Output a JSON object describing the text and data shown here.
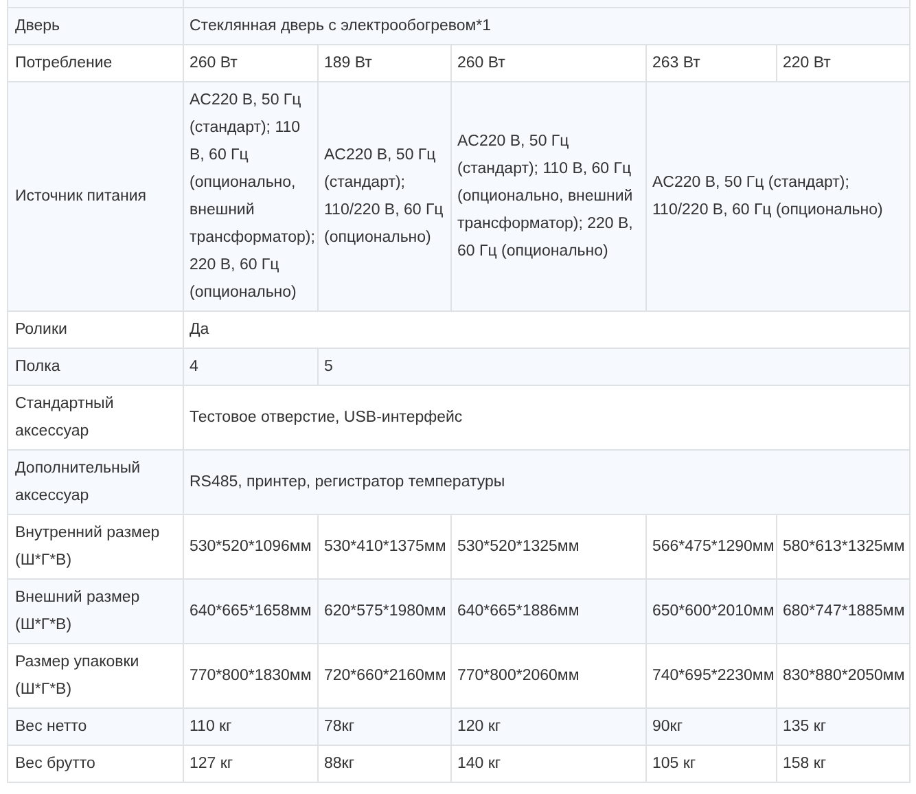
{
  "table": {
    "rows": [
      {
        "label": "Дверь",
        "cells": [
          {
            "text": "Стеклянная дверь с электрообогревом*1",
            "colspan": 5
          }
        ]
      },
      {
        "label": "Потребление",
        "cells": [
          {
            "text": "260 Вт"
          },
          {
            "text": "189 Вт"
          },
          {
            "text": "260 Вт"
          },
          {
            "text": "263 Вт"
          },
          {
            "text": "220 Вт"
          }
        ]
      },
      {
        "label": "Источник питания",
        "cells": [
          {
            "text": "AC220 В, 50 Гц (стандарт); 110 В, 60 Гц (опционально, внешний трансформатор); 220 В, 60 Гц (опционально)"
          },
          {
            "text": "AC220 В, 50 Гц (стандарт); 110/220 В, 60 Гц (опционально)"
          },
          {
            "text": "AC220 В, 50 Гц (стандарт); 110 В, 60 Гц (опционально, внешний трансформатор); 220 В, 60 Гц (опционально)"
          },
          {
            "text": "AC220 В, 50 Гц (стандарт); 110/220 В, 60 Гц (опционально)",
            "colspan": 2
          }
        ]
      },
      {
        "label": "Ролики",
        "cells": [
          {
            "text": "Да",
            "colspan": 5
          }
        ]
      },
      {
        "label": "Полка",
        "cells": [
          {
            "text": "4"
          },
          {
            "text": "5",
            "colspan": 4
          }
        ]
      },
      {
        "label": "Стандартный аксессуар",
        "cells": [
          {
            "text": "Тестовое отверстие, USB-интерфейс",
            "colspan": 5
          }
        ]
      },
      {
        "label": "Дополнительный аксессуар",
        "cells": [
          {
            "text": "RS485, принтер, регистратор температуры",
            "colspan": 5
          }
        ]
      },
      {
        "label": "Внутренний размер (Ш*Г*В)",
        "cells": [
          {
            "text": "530*520*1096мм"
          },
          {
            "text": "530*410*1375мм"
          },
          {
            "text": "530*520*1325мм"
          },
          {
            "text": "566*475*1290мм"
          },
          {
            "text": "580*613*1325мм"
          }
        ]
      },
      {
        "label": "Внешний размер (Ш*Г*В)",
        "cells": [
          {
            "text": "640*665*1658мм"
          },
          {
            "text": "620*575*1980мм"
          },
          {
            "text": "640*665*1886мм"
          },
          {
            "text": "650*600*2010мм"
          },
          {
            "text": "680*747*1885мм"
          }
        ]
      },
      {
        "label": "Размер упаковки (Ш*Г*В)",
        "cells": [
          {
            "text": "770*800*1830мм"
          },
          {
            "text": "720*660*2160мм"
          },
          {
            "text": "770*800*2060мм"
          },
          {
            "text": "740*695*2230мм"
          },
          {
            "text": "830*880*2050мм"
          }
        ]
      },
      {
        "label": "Вес нетто",
        "cells": [
          {
            "text": "110 кг"
          },
          {
            "text": "78кг"
          },
          {
            "text": "120 кг"
          },
          {
            "text": "90кг"
          },
          {
            "text": "135 кг"
          }
        ]
      },
      {
        "label": "Вес брутто",
        "cells": [
          {
            "text": "127 кг"
          },
          {
            "text": "88кг"
          },
          {
            "text": "140 кг"
          },
          {
            "text": "105 кг"
          },
          {
            "text": "158 кг"
          }
        ]
      }
    ]
  }
}
